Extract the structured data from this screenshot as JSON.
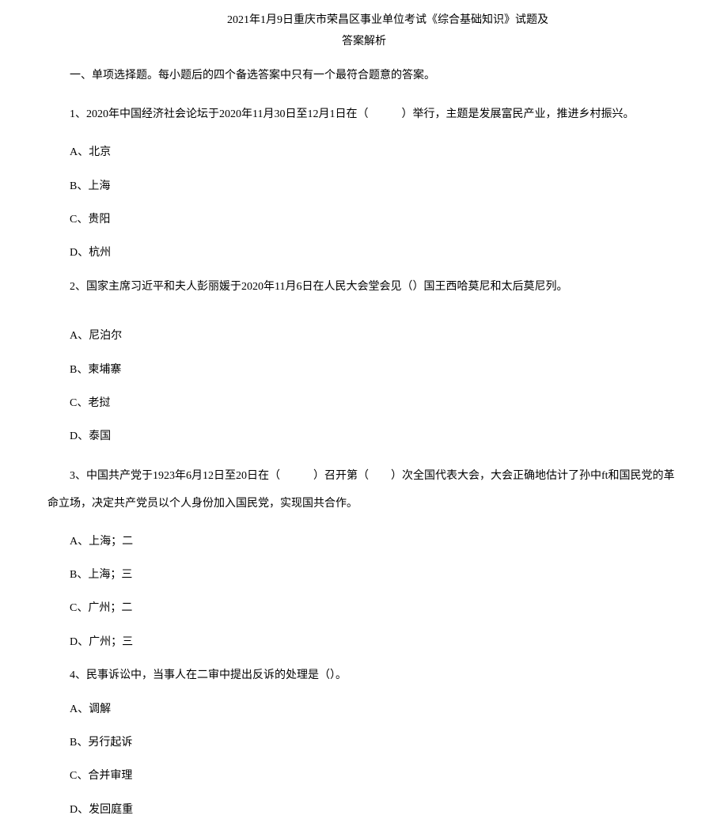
{
  "title": {
    "line1": "2021年1月9日重庆市荣昌区事业单位考试《综合基础知识》试题及",
    "line2": "答案解析"
  },
  "section_heading": "一、单项选择题。每小题后的四个备选答案中只有一个最符合题意的答案。",
  "questions": [
    {
      "stem": "1、2020年中国经济社会论坛于2020年11月30日至12月1日在（　　　）举行，主题是发展富民产业，推进乡村振兴。",
      "options": [
        "A、北京",
        "B、上海",
        "C、贵阳",
        "D、杭州"
      ]
    },
    {
      "stem": "2、国家主席习近平和夫人彭丽媛于2020年11月6日在人民大会堂会见（）国王西哈莫尼和太后莫尼列。",
      "options": [
        "A、尼泊尔",
        "B、柬埔寨",
        "C、老挝",
        "D、泰国"
      ]
    },
    {
      "stem": "3、中国共产党于1923年6月12日至20日在（　　　）召开第（　　）次全国代表大会，大会正确地估计了孙中ft和国民党的革命立场，决定共产党员以个人身份加入国民党，实现国共合作。",
      "options": [
        "A、上海；二",
        "B、上海；三",
        "C、广州；二",
        "D、广州；三"
      ]
    },
    {
      "stem": "4、民事诉讼中，当事人在二审中提出反诉的处理是（）。",
      "options": [
        "A、调解",
        "B、另行起诉",
        "C、合并审理",
        "D、发回庭重"
      ]
    }
  ]
}
